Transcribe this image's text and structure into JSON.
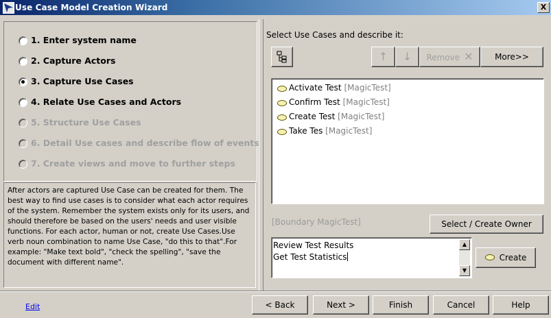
{
  "window": {
    "title": "Use Case Model Creation Wizard",
    "close_label": "X"
  },
  "steps": [
    {
      "label": "1. Enter system name",
      "selected": false,
      "enabled": true
    },
    {
      "label": "2. Capture Actors",
      "selected": false,
      "enabled": true
    },
    {
      "label": "3. Capture Use Cases",
      "selected": true,
      "enabled": true
    },
    {
      "label": "4. Relate Use Cases and Actors",
      "selected": false,
      "enabled": true
    },
    {
      "label": "5. Structure Use Cases",
      "selected": false,
      "enabled": false
    },
    {
      "label": "6. Detail Use cases and describe flow of events",
      "selected": false,
      "enabled": false
    },
    {
      "label": "7. Create views and move to further steps",
      "selected": false,
      "enabled": false
    }
  ],
  "description": "After actors are captured Use Case can be created for them. The best way to find use cases is to consider what each actor requires of the system. Remember the system exists only for its users, and should therefore be based on the users' needs and user visible functions. For each actor, human or not, create Use Cases.Use verb noun combination to name Use Case, \"do this to that\".For example: \"Make text bold\", \"check the spelling\", \"save the document with different name\".",
  "right": {
    "title": "Select Use Cases and describe it:",
    "toolbar": {
      "tree_icon": "tree-view-icon",
      "up_label": "↑",
      "down_label": "↓",
      "remove_label": "Remove",
      "remove_icon": "✕",
      "more_label": "More>>"
    },
    "use_cases": [
      {
        "name": "Activate Test",
        "owner": "[MagicTest]"
      },
      {
        "name": "Confirm Test",
        "owner": "[MagicTest]"
      },
      {
        "name": "Create Test",
        "owner": "[MagicTest]"
      },
      {
        "name": "Take Tes",
        "owner": "[MagicTest]"
      }
    ],
    "owner_label": "[Boundary MagicTest]",
    "owner_button": "Select / Create Owner",
    "new_names": [
      "Review Test Results",
      "Get Test Statistics"
    ],
    "create_label": "Create"
  },
  "footer": {
    "edit_link": "Edit",
    "back": "< Back",
    "next": "Next >",
    "finish": "Finish",
    "cancel": "Cancel",
    "help": "Help"
  },
  "colors": {
    "title_bar_start": "#0a246a",
    "title_bar_end": "#a6caf0",
    "face": "#d4d0c8",
    "disabled_text": "#a0a0a0",
    "link": "#0000ee",
    "use_case_fill": "#f6f1b3"
  }
}
